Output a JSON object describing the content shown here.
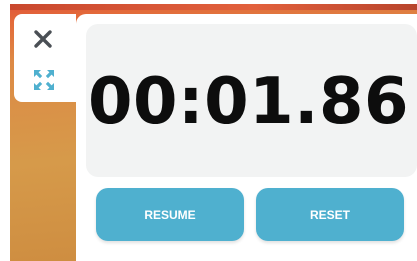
{
  "stopwatch": {
    "time": "00:01.86",
    "resume_label": "RESUME",
    "reset_label": "RESET"
  },
  "controls": {
    "close_icon": "close-icon",
    "expand_icon": "expand-icon"
  },
  "colors": {
    "accent": "#4fb0cf",
    "display_background": "#f2f3f3",
    "time_text": "#0d0d0d",
    "icon_dark": "#4a4f55"
  }
}
